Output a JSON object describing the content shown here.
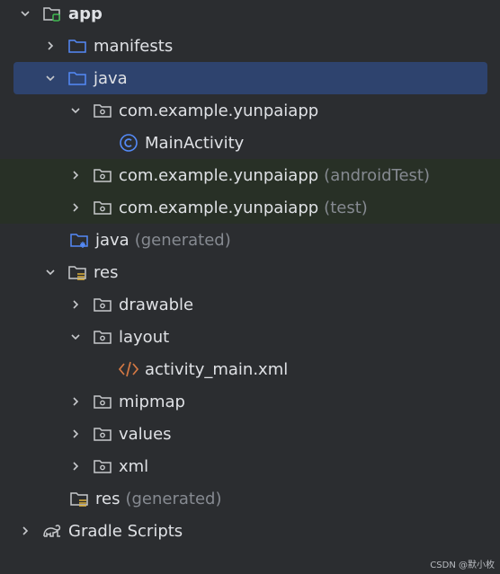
{
  "tree": [
    {
      "label": "app",
      "suffix": "",
      "icon": "module-folder-icon",
      "expanded": true,
      "bold": true
    },
    {
      "label": "manifests",
      "suffix": "",
      "icon": "folder-icon",
      "expanded": false
    },
    {
      "label": "java",
      "suffix": "",
      "icon": "folder-icon",
      "expanded": true,
      "selected": true
    },
    {
      "label": "com.example.yunpaiapp",
      "suffix": "",
      "icon": "package-icon",
      "expanded": true
    },
    {
      "label": "MainActivity",
      "suffix": "",
      "icon": "class-icon"
    },
    {
      "label": "com.example.yunpaiapp",
      "suffix": "(androidTest)",
      "icon": "package-icon",
      "expanded": false
    },
    {
      "label": "com.example.yunpaiapp",
      "suffix": "(test)",
      "icon": "package-icon",
      "expanded": false
    },
    {
      "label": "java",
      "suffix": "(generated)",
      "icon": "generated-java-folder-icon"
    },
    {
      "label": "res",
      "suffix": "",
      "icon": "resource-folder-icon",
      "expanded": true
    },
    {
      "label": "drawable",
      "suffix": "",
      "icon": "package-icon",
      "expanded": false
    },
    {
      "label": "layout",
      "suffix": "",
      "icon": "package-icon",
      "expanded": true
    },
    {
      "label": "activity_main.xml",
      "suffix": "",
      "icon": "xml-file-icon"
    },
    {
      "label": "mipmap",
      "suffix": "",
      "icon": "package-icon",
      "expanded": false
    },
    {
      "label": "values",
      "suffix": "",
      "icon": "package-icon",
      "expanded": false
    },
    {
      "label": "xml",
      "suffix": "",
      "icon": "package-icon",
      "expanded": false
    },
    {
      "label": "res",
      "suffix": "(generated)",
      "icon": "resource-folder-icon"
    },
    {
      "label": "Gradle Scripts",
      "suffix": "",
      "icon": "gradle-icon",
      "expanded": false
    }
  ],
  "watermark": "CSDN @默小枚",
  "colors": {
    "background": "#2b2d30",
    "selection": "#2e436e",
    "test_tint": "#283026",
    "folder_blue": "#548af7",
    "class_blue": "#548af7",
    "xml_orange": "#d47843",
    "muted": "#868a91"
  }
}
